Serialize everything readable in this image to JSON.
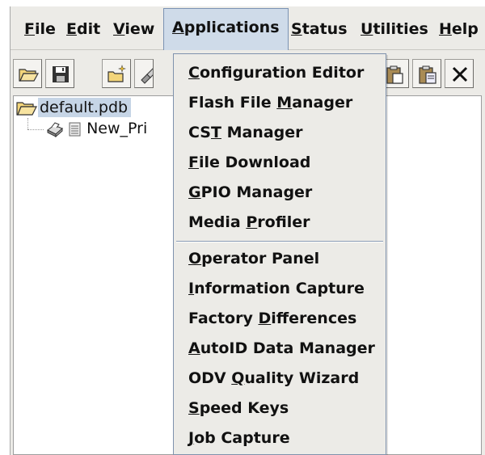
{
  "menubar": {
    "items": [
      {
        "id": "file",
        "pre": "",
        "mn": "F",
        "post": "ile",
        "active": false
      },
      {
        "id": "edit",
        "pre": "",
        "mn": "E",
        "post": "dit",
        "active": false
      },
      {
        "id": "view",
        "pre": "",
        "mn": "V",
        "post": "iew",
        "active": false
      },
      {
        "id": "apps",
        "pre": "",
        "mn": "A",
        "post": "pplications",
        "active": true
      },
      {
        "id": "status",
        "pre": "",
        "mn": "S",
        "post": "tatus",
        "active": false
      },
      {
        "id": "util",
        "pre": "",
        "mn": "U",
        "post": "tilities",
        "active": false
      },
      {
        "id": "help",
        "pre": "",
        "mn": "H",
        "post": "elp",
        "active": false
      }
    ]
  },
  "toolbar": {
    "buttons": [
      "open-folder-icon",
      "save-icon",
      "new-item-icon",
      "tool-icon",
      "copy-icon",
      "paste-icon",
      "delete-icon"
    ]
  },
  "tree": {
    "root": {
      "label": "default.pdb",
      "icon": "open-folder-icon",
      "selected": true
    },
    "child": {
      "label": "New_Pri",
      "icon": "printer-icon"
    }
  },
  "applications_menu": {
    "group1": [
      {
        "pre": "",
        "mn": "C",
        "post": "onfiguration Editor"
      },
      {
        "pre": "Flash File ",
        "mn": "M",
        "post": "anager"
      },
      {
        "pre": "CS",
        "mn": "T",
        "post": " Manager"
      },
      {
        "pre": "",
        "mn": "F",
        "post": "ile Download"
      },
      {
        "pre": "",
        "mn": "G",
        "post": "PIO Manager"
      },
      {
        "pre": "Media ",
        "mn": "P",
        "post": "rofiler"
      }
    ],
    "group2": [
      {
        "pre": "",
        "mn": "O",
        "post": "perator Panel"
      },
      {
        "pre": "",
        "mn": "I",
        "post": "nformation Capture"
      },
      {
        "pre": "Factory ",
        "mn": "D",
        "post": "ifferences"
      },
      {
        "pre": "",
        "mn": "A",
        "post": "utoID Data Manager"
      },
      {
        "pre": "ODV ",
        "mn": "Q",
        "post": "uality Wizard"
      },
      {
        "pre": "",
        "mn": "S",
        "post": "peed Keys"
      },
      {
        "pre": "",
        "mn": "J",
        "post": "ob Capture"
      }
    ]
  },
  "colors": {
    "menu_active_bg": "#cfdbe9",
    "selection_bg": "#c6d5e6",
    "chrome_bg": "#ecebe7"
  }
}
